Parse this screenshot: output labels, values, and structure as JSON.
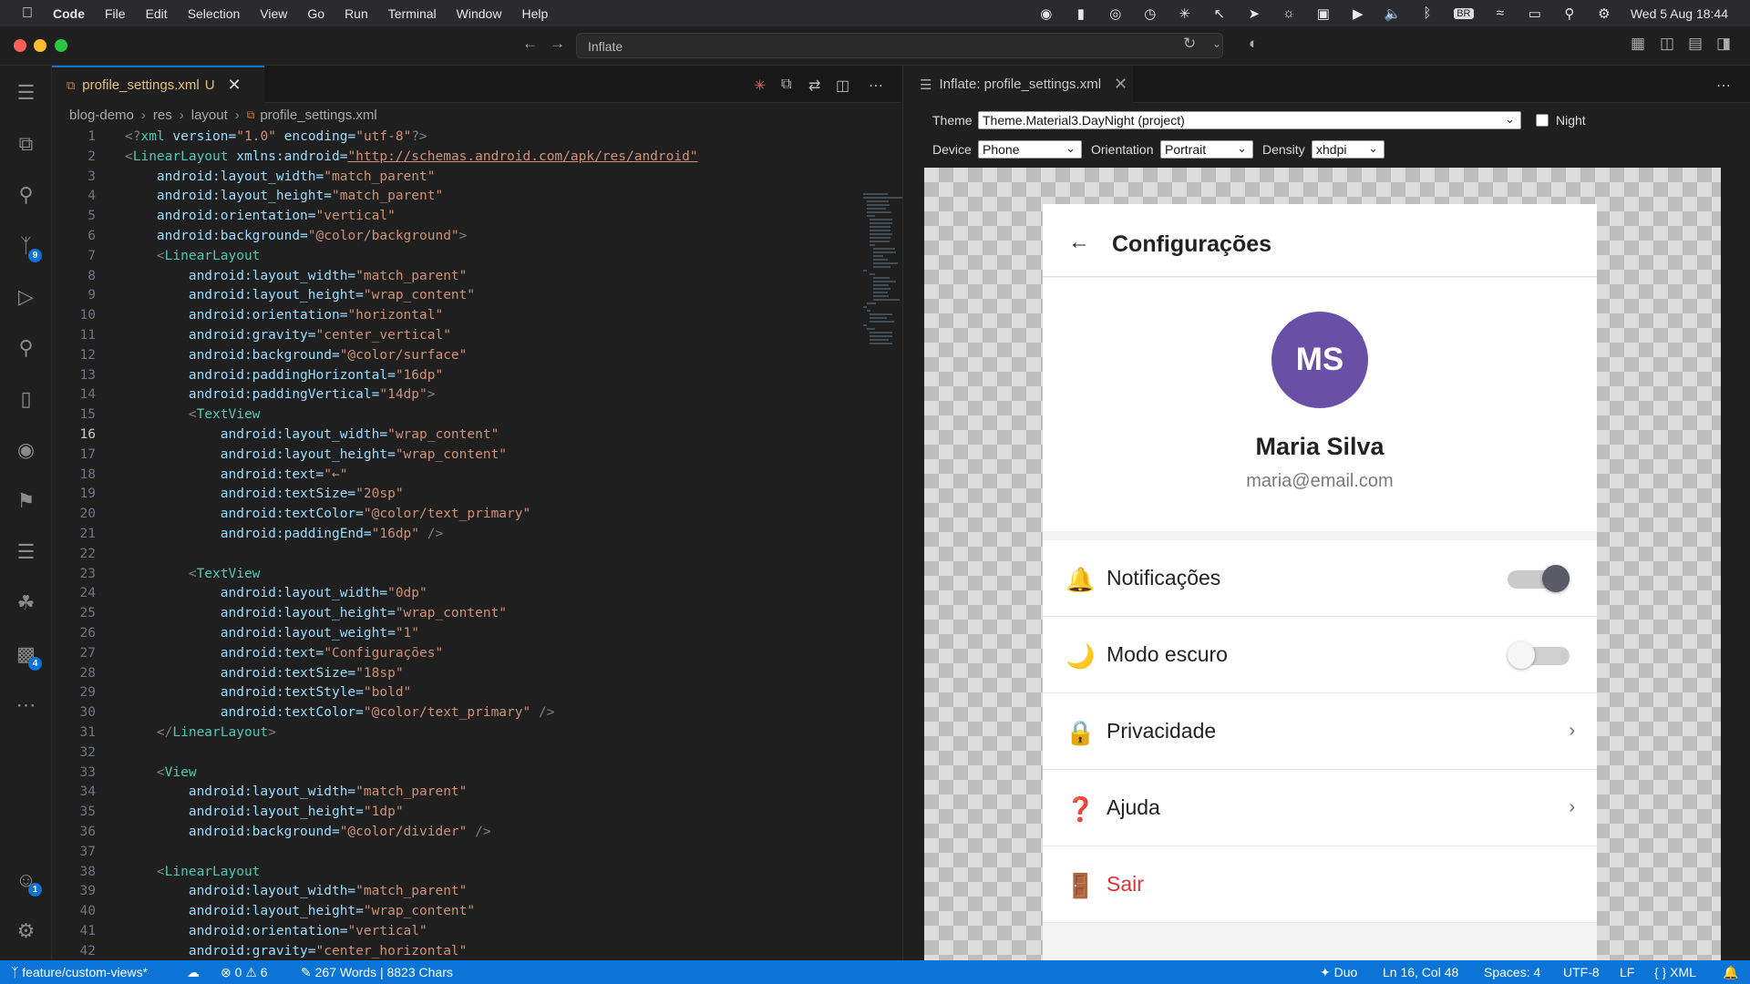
{
  "menubar": {
    "app_name": "Code",
    "items": [
      "File",
      "Edit",
      "Selection",
      "View",
      "Go",
      "Run",
      "Terminal",
      "Window",
      "Help"
    ],
    "input_source": "BR",
    "clock": "Wed 5 Aug  18:44"
  },
  "titlebar": {
    "search_text": "Inflate"
  },
  "activity_bar": {
    "source_control_badge": "9",
    "extensions_badge": "4",
    "accounts_badge": "1"
  },
  "editor": {
    "tab": {
      "label": "profile_settings.xml",
      "modified_flag": "U"
    },
    "breadcrumb": [
      "blog-demo",
      "res",
      "layout",
      "profile_settings.xml"
    ],
    "current_line": 16,
    "line_numbers": [
      "1",
      "2",
      "3",
      "4",
      "5",
      "6",
      "7",
      "8",
      "9",
      "10",
      "11",
      "12",
      "13",
      "14",
      "15",
      "16",
      "17",
      "18",
      "19",
      "20",
      "21",
      "22",
      "23",
      "24",
      "25",
      "26",
      "27",
      "28",
      "29",
      "30",
      "31",
      "32",
      "33",
      "34",
      "35",
      "36",
      "37",
      "38",
      "39",
      "40",
      "41",
      "42"
    ],
    "lines": [
      "<?xml version=\"1.0\" encoding=\"utf-8\"?>",
      "<LinearLayout xmlns:android=\"http://schemas.android.com/apk/res/android\"",
      "    android:layout_width=\"match_parent\"",
      "    android:layout_height=\"match_parent\"",
      "    android:orientation=\"vertical\"",
      "    android:background=\"@color/background\">",
      "    <LinearLayout",
      "        android:layout_width=\"match_parent\"",
      "        android:layout_height=\"wrap_content\"",
      "        android:orientation=\"horizontal\"",
      "        android:gravity=\"center_vertical\"",
      "        android:background=\"@color/surface\"",
      "        android:paddingHorizontal=\"16dp\"",
      "        android:paddingVertical=\"14dp\">",
      "        <TextView",
      "            android:layout_width=\"wrap_content\"",
      "            android:layout_height=\"wrap_content\"",
      "            android:text=\"←\"",
      "            android:textSize=\"20sp\"",
      "            android:textColor=\"@color/text_primary\"",
      "            android:paddingEnd=\"16dp\" />",
      "",
      "        <TextView",
      "            android:layout_width=\"0dp\"",
      "            android:layout_height=\"wrap_content\"",
      "            android:layout_weight=\"1\"",
      "            android:text=\"Configurações\"",
      "            android:textSize=\"18sp\"",
      "            android:textStyle=\"bold\"",
      "            android:textColor=\"@color/text_primary\" />",
      "    </LinearLayout>",
      "",
      "    <View",
      "        android:layout_width=\"match_parent\"",
      "        android:layout_height=\"1dp\"",
      "        android:background=\"@color/divider\" />",
      "",
      "    <LinearLayout",
      "        android:layout_width=\"match_parent\"",
      "        android:layout_height=\"wrap_content\"",
      "        android:orientation=\"vertical\"",
      "        android:gravity=\"center_horizontal\""
    ]
  },
  "preview": {
    "tab_label": "Inflate: profile_settings.xml",
    "theme_label": "Theme",
    "theme_value": "Theme.Material3.DayNight (project)",
    "night_label": "Night",
    "night_checked": false,
    "device_label": "Device",
    "device_value": "Phone",
    "orientation_label": "Orientation",
    "orientation_value": "Portrait",
    "density_label": "Density",
    "density_value": "xhdpi",
    "app": {
      "back": "←",
      "title": "Configurações",
      "avatar_initials": "MS",
      "avatar_color": "#6a4fa6",
      "name": "Maria Silva",
      "email": "maria@email.com",
      "rows": [
        {
          "icon": "🔔",
          "icon_name": "bell-icon",
          "label": "Notificações",
          "control": "switch",
          "on": true
        },
        {
          "icon": "🌙",
          "icon_name": "moon-icon",
          "label": "Modo escuro",
          "control": "switch",
          "on": false
        },
        {
          "icon": "🔒",
          "icon_name": "lock-icon",
          "label": "Privacidade",
          "control": "chevron"
        },
        {
          "icon": "❓",
          "icon_name": "question-icon",
          "label": "Ajuda",
          "control": "chevron"
        },
        {
          "icon": "🚪",
          "icon_name": "door-icon",
          "label": "Sair",
          "control": "none",
          "danger": true
        }
      ],
      "chevron": "›",
      "danger_color": "#d33333"
    }
  },
  "statusbar": {
    "branch": "feature/custom-views*",
    "errors": "0",
    "warnings": "6",
    "word_count": "267 Words | 8823 Chars",
    "copilot": "Duo",
    "cursor": "Ln 16, Col 48",
    "indent": "Spaces: 4",
    "encoding": "UTF-8",
    "eol": "LF",
    "language": "XML",
    "accent_color": "#0b74d6"
  }
}
